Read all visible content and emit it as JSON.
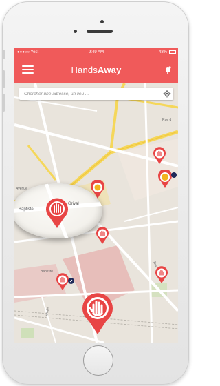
{
  "status_bar": {
    "carrier": "●●●○○ Yest",
    "time": "9:49 AM",
    "battery": "48%"
  },
  "header": {
    "title_prefix": "Hands",
    "title_bold": "Away",
    "menu_icon": "hamburger-menu-icon",
    "notification_icon": "notification-bell-icon"
  },
  "search": {
    "placeholder": "Chercher une adresse, un lieu ...",
    "locate_icon": "crosshair-locate-icon"
  },
  "map": {
    "street_labels": [
      "Avenue",
      "Rue d",
      "Rue",
      "Baptiste",
      "Crimée"
    ],
    "magnifier_labels": [
      "Baptiste",
      "Grival"
    ]
  },
  "colors": {
    "brand": "#f05a5a",
    "pin_red": "#e84545",
    "pin_yellow": "#f2b31f",
    "badge_navy": "#1f2a5a",
    "map_bg": "#e9e4dc",
    "road_yellow": "#f5d75a",
    "block_pink": "#e6b7b4"
  }
}
